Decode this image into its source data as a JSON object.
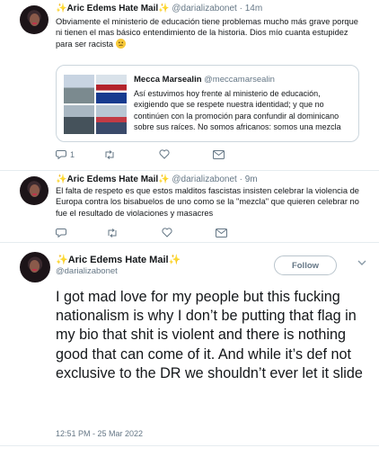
{
  "tweets": [
    {
      "name": "",
      "handle": "@darializabonet",
      "time": "14m",
      "text": "Obviamente el ministerio de educación tiene problemas mucho más grave porque ni tienen el mas básico entendimiento de la historia. Dios mío cuanta estupidez para ser racista",
      "emoji": "confused-face-emoji",
      "reply_count": "1",
      "quote": {
        "name": "Mecca Marsealin",
        "handle": "@meccamarsealin",
        "text": "Así estuvimos hoy frente al ministerio de educación, exigiendo que se respete nuestra identidad; y que no continúen con la promoción para confundir al dominicano sobre sus raíces. No somos africanos: somos una mezcla"
      }
    },
    {
      "name": "Aric Edems Hate Mail",
      "handle": "@darializabonet",
      "time": "9m",
      "text": "El falta de respeto es que estos malditos fascistas insisten celebrar la violencia de Europa contra los bisabuelos de uno como se la \"mezcla\" que quieren celebrar no fue el resultado de violaciones y masacres",
      "reply_count": ""
    }
  ],
  "main": {
    "name": "Aric Edems Hate Mail",
    "handle": "@darializabonet",
    "follow_label": "Follow",
    "text": "I got mad love for my people but this fucking nationalism is why I don’t be putting that flag in my bio that shit is violent and there is nothing good that can come of it. And while it’s def not exclusive to the DR we shouldn’t ever let it slide",
    "timestamp": "12:51 PM - 25 Mar 2022"
  },
  "first_tweet_name": "Aric Edems Hate Mail",
  "colors": {
    "sparkle": "#f5b400",
    "text": "#14171a",
    "muted": "#657786",
    "border": "#e6ecf0"
  }
}
